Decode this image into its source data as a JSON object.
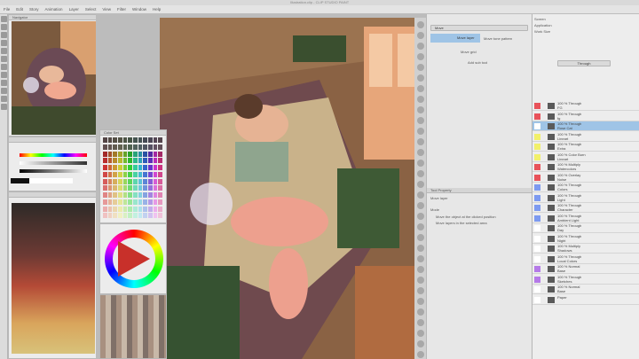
{
  "window": {
    "title": "Illustration.clip - CLIP STUDIO PAINT"
  },
  "menu": [
    "File",
    "Edit",
    "Story",
    "Animation",
    "Layer",
    "Select",
    "View",
    "Filter",
    "Window",
    "Help"
  ],
  "navigator": {
    "label": "Navigator"
  },
  "color_set": {
    "label": "Color Set"
  },
  "color_wheel": {
    "label": "Color Wheel"
  },
  "sub_tool": {
    "items": [
      "Move",
      "Move layer",
      "Move tone pattern",
      "Move grid"
    ],
    "add_button": "Add sub tool"
  },
  "tool_property": {
    "label": "Tool Property",
    "title": "Move layer",
    "mode_label": "Mode",
    "options": [
      "Move the object at the clicked position",
      "Move layers in the selected area"
    ]
  },
  "layer_props": {
    "screen_label": "Screen",
    "application_label": "Application",
    "work_size_label": "Work Size"
  },
  "layers": {
    "blend_top": "Through",
    "rows": [
      {
        "name": "100 % Through\nFG",
        "color": "#e8525a"
      },
      {
        "name": "100 % Through\nfg",
        "color": "#e8525a"
      },
      {
        "name": "100 % Through\nRose Cat",
        "color": "#ffffff",
        "selected": true
      },
      {
        "name": "100 % Through\nLineart",
        "color": "#f2f06a"
      },
      {
        "name": "100 % Through\nExtra",
        "color": "#f2f06a"
      },
      {
        "name": "100 % Color Burn\nLineart",
        "color": "#f2f06a"
      },
      {
        "name": "100 % Multiply\nWatercolors",
        "color": "#e8525a"
      },
      {
        "name": "100 % Overlay\nNoise",
        "color": "#e8525a"
      },
      {
        "name": "100 % Through\nColors",
        "color": "#7d9af0"
      },
      {
        "name": "100 % Through\nLight",
        "color": "#7d9af0"
      },
      {
        "name": "100 % Through\nCharacter",
        "color": "#7d9af0"
      },
      {
        "name": "100 % Through\nAmbient Light",
        "color": "#7d9af0"
      },
      {
        "name": "100 % Through\nDay",
        "color": "#ffffff"
      },
      {
        "name": "100 % Through\nNight",
        "color": "#ffffff"
      },
      {
        "name": "100 % Multiply\nShadows",
        "color": "#ffffff"
      },
      {
        "name": "100 % Through\nLocal Colors",
        "color": "#ffffff"
      },
      {
        "name": "100 % Normal\nBase",
        "color": "#b57ae8"
      },
      {
        "name": "100 % Through\nSketches",
        "color": "#b57ae8"
      },
      {
        "name": "100 % Normal\nBase",
        "color": "#ffffff"
      },
      {
        "name": "Paper",
        "color": "#ffffff"
      }
    ]
  },
  "colors": {
    "accent": "#9fc4e6"
  }
}
